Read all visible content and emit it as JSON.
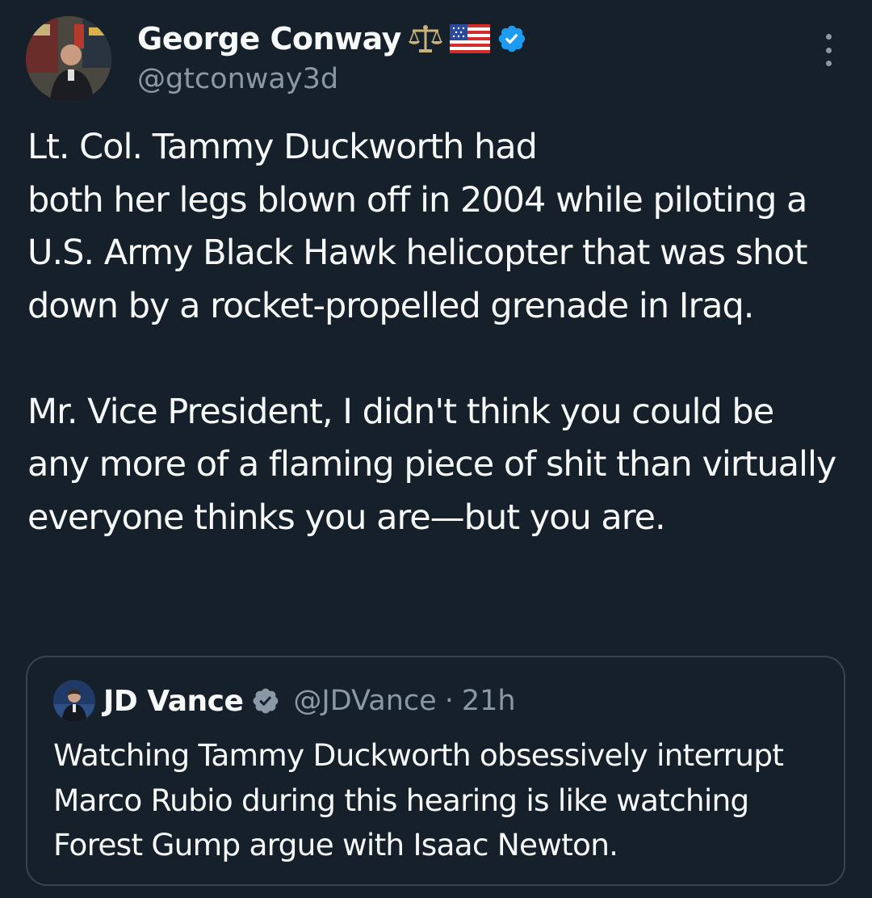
{
  "author": {
    "display_name": "George Conway",
    "handle": "@gtconway3d",
    "badge_emojis": [
      "scales-icon",
      "us-flag-icon"
    ],
    "verified": true
  },
  "tweet": {
    "text": "Lt.  Col. Tammy Duckworth had\nboth her legs blown off in 2004 while piloting a U.S. Army Black Hawk helicopter that was shot down by a rocket-propelled grenade in Iraq.\n\nMr. Vice President, I didn't think you could be any more of a flaming piece of shit than virtually everyone thinks you are—but you are."
  },
  "quoted": {
    "display_name": "JD Vance",
    "handle": "@JDVance",
    "separator": "·",
    "time": "21h",
    "verified": true,
    "text": "Watching Tammy Duckworth obsessively interrupt Marco Rubio during this hearing is like watching Forest Gump argue with Isaac Newton."
  },
  "colors": {
    "background": "#15202b",
    "text_primary": "#f7f9f9",
    "text_secondary": "#8b98a5",
    "verified_blue": "#1d9bf0",
    "quote_border": "#38444d"
  }
}
